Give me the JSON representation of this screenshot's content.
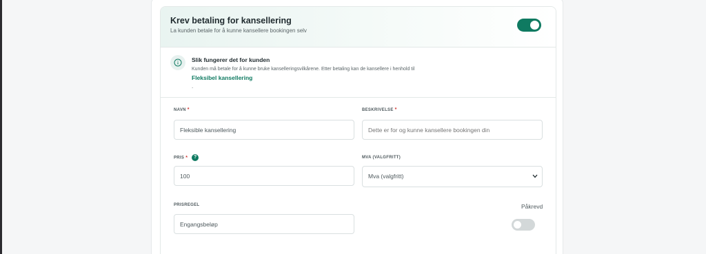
{
  "header": {
    "title": "Krev betaling for kansellering",
    "subtitle": "La kunden betale for å kunne kansellere bookingen selv",
    "toggle_state": "on"
  },
  "info": {
    "icon": "info-icon",
    "title": "Slik fungerer det for kunden",
    "text": "Kunden må betale for å kunne bruke kanselleringsvilkårene. Etter betaling kan de kansellere i henhold til",
    "link": "Fleksibel kansellering",
    "trailing": "."
  },
  "form": {
    "name": {
      "label": "NAVN",
      "required_mark": "*",
      "value": "Fleksible kansellering"
    },
    "description": {
      "label": "BESKRIVELSE",
      "required_mark": "*",
      "placeholder": "Dette er for og kunne kansellere bookingen din"
    },
    "price": {
      "label": "PRIS",
      "required_mark": "*",
      "help": "?",
      "value": "100"
    },
    "vat": {
      "label": "MVA (VALGFRITT)",
      "selected": "Mva (valgfritt)"
    },
    "price_rule": {
      "label": "PRISREGEL",
      "value": "Engangsbeløp"
    },
    "required": {
      "label": "Påkrevd",
      "toggle_state": "off"
    }
  },
  "colors": {
    "accent": "#0f7a61",
    "required": "#d0312d",
    "toggle_off": "#d3d8d9"
  }
}
